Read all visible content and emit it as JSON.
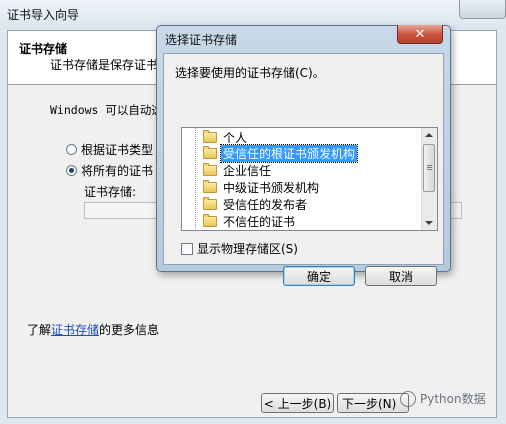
{
  "wizard": {
    "title": "证书导入向导",
    "header_title": "证书存储",
    "header_desc": "证书存储是保存证书",
    "auto_text": "Windows 可以自动选",
    "radio_auto_label": "根据证书类型",
    "radio_manual_label": "将所有的证书",
    "store_label": "证书存储:",
    "store_value": "",
    "learn_more_prefix": "了解",
    "learn_more_link": "证书存储",
    "learn_more_suffix": "的更多信息",
    "back_button": "< 上一步(B)",
    "next_button": "下一步(N)",
    "watermark": "Python数据"
  },
  "dialog": {
    "title": "选择证书存储",
    "prompt": "选择要使用的证书存储(C)。",
    "tree_items": [
      {
        "label": "个人",
        "selected": false
      },
      {
        "label": "受信任的根证书颁发机构",
        "selected": true
      },
      {
        "label": "企业信任",
        "selected": false
      },
      {
        "label": "中级证书颁发机构",
        "selected": false
      },
      {
        "label": "受信任的发布者",
        "selected": false
      },
      {
        "label": "不信任的证书",
        "selected": false
      }
    ],
    "show_physical_label": "显示物理存储区(S)",
    "show_physical_checked": false,
    "ok_button": "确定",
    "cancel_button": "取消",
    "close_glyph": "✕"
  },
  "icons": {
    "folder": "folder-icon",
    "close": "close-icon",
    "radio": "radio-button",
    "checkbox": "checkbox",
    "watermark": "wechat-icon"
  },
  "colors": {
    "selection": "#3399ff",
    "link": "#1a4fbf",
    "close_button": "#c9523c",
    "dialog_frame": "#c8d8e8"
  }
}
